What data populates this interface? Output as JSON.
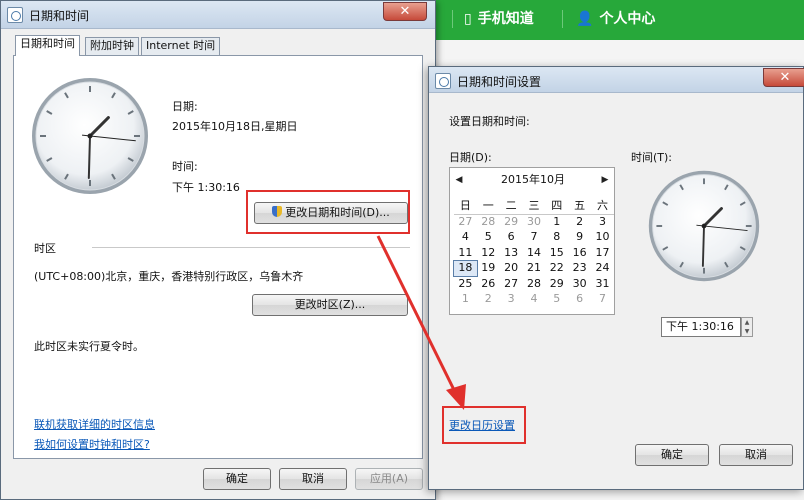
{
  "background_page": {
    "nav_left": "手机知道",
    "nav_right": "个人中心"
  },
  "main_window": {
    "title": "日期和时间",
    "close_label": "✕",
    "tabs": [
      {
        "label": "日期和时间",
        "active": true
      },
      {
        "label": "附加时钟",
        "active": false
      },
      {
        "label": "Internet 时间",
        "active": false
      }
    ],
    "date_label": "日期:",
    "date_value": "2015年10月18日,星期日",
    "time_label": "时间:",
    "time_value": "下午 1:30:16",
    "change_datetime_button": "更改日期和时间(D)...",
    "timezone_heading": "时区",
    "timezone_value": "(UTC+08:00)北京，重庆，香港特别行政区，乌鲁木齐",
    "change_timezone_button": "更改时区(Z)...",
    "dst_note": "此时区未实行夏令时。",
    "link_timezone_info": "联机获取详细的时区信息",
    "link_how_to": "我如何设置时钟和时区?",
    "ok_button": "确定",
    "cancel_button": "取消",
    "apply_button": "应用(A)"
  },
  "settings_window": {
    "title": "日期和时间设置",
    "close_label": "✕",
    "instruction": "设置日期和时间:",
    "date_label": "日期(D):",
    "time_label": "时间(T):",
    "calendar": {
      "month_title": "2015年10月",
      "prev_arrow": "◀",
      "next_arrow": "▶",
      "weekdays": [
        "日",
        "一",
        "二",
        "三",
        "四",
        "五",
        "六"
      ],
      "weeks": [
        [
          "27",
          "28",
          "29",
          "30",
          "1",
          "2",
          "3"
        ],
        [
          "4",
          "5",
          "6",
          "7",
          "8",
          "9",
          "10"
        ],
        [
          "11",
          "12",
          "13",
          "14",
          "15",
          "16",
          "17"
        ],
        [
          "18",
          "19",
          "20",
          "21",
          "22",
          "23",
          "24"
        ],
        [
          "25",
          "26",
          "27",
          "28",
          "29",
          "30",
          "31"
        ],
        [
          "1",
          "2",
          "3",
          "4",
          "5",
          "6",
          "7"
        ]
      ],
      "selected_day": "18"
    },
    "time_value": "下午  1:30:16",
    "change_calendar_link": "更改日历设置",
    "ok_button": "确定",
    "cancel_button": "取消"
  },
  "clock": {
    "hour": 1,
    "minute": 30,
    "second": 16
  },
  "colors": {
    "annotation_red": "#e0302c",
    "web_green": "#27a83a",
    "link_blue": "#0a58b8"
  }
}
